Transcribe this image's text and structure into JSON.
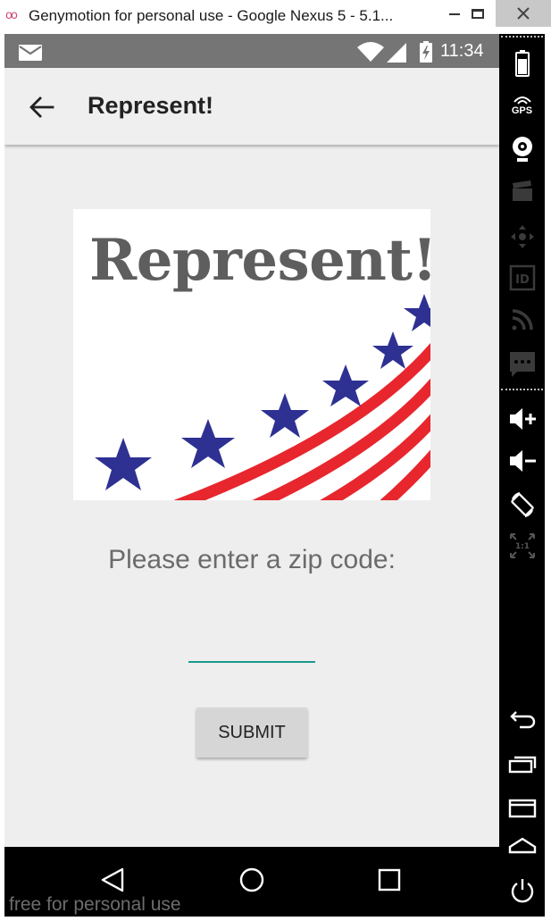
{
  "window": {
    "title": "Genymotion for personal use - Google Nexus 5 - 5.1...",
    "icon": "genymotion-icon",
    "controls": [
      "minimize-icon",
      "maximize-icon",
      "close-icon"
    ]
  },
  "status_bar": {
    "time": "11:34",
    "icons": [
      "mail-icon",
      "wifi-icon",
      "signal-icon",
      "battery-charging-icon"
    ]
  },
  "app_bar": {
    "title": "Represent!",
    "back_icon": "arrow-back-icon"
  },
  "logo": {
    "text": "Represent!",
    "colors": {
      "star": "#2e3192",
      "stripe": "#e8262e",
      "text": "#5e5e5e"
    }
  },
  "form": {
    "prompt": "Please enter a zip code:",
    "zip_value": "",
    "zip_placeholder": "",
    "submit_label": "SUBMIT",
    "accent": "#1a9a8c"
  },
  "nav_bar": {
    "icons": [
      "nav-back-icon",
      "nav-home-icon",
      "nav-recent-apps-icon"
    ],
    "watermark": "free for personal use"
  },
  "sidebar": {
    "gps_label": "GPS",
    "ratio_label": "1:1",
    "icons": [
      "battery-icon",
      "gps-icon",
      "webcam-icon",
      "video-capture-icon",
      "remote-control-icon",
      "device-id-icon",
      "network-icon",
      "sms-icon",
      "volume-up-icon",
      "volume-down-icon",
      "rotate-icon",
      "pixel-perfect-icon",
      "back-icon",
      "recent-apps-icon",
      "menu-icon",
      "home-icon",
      "power-icon"
    ]
  }
}
